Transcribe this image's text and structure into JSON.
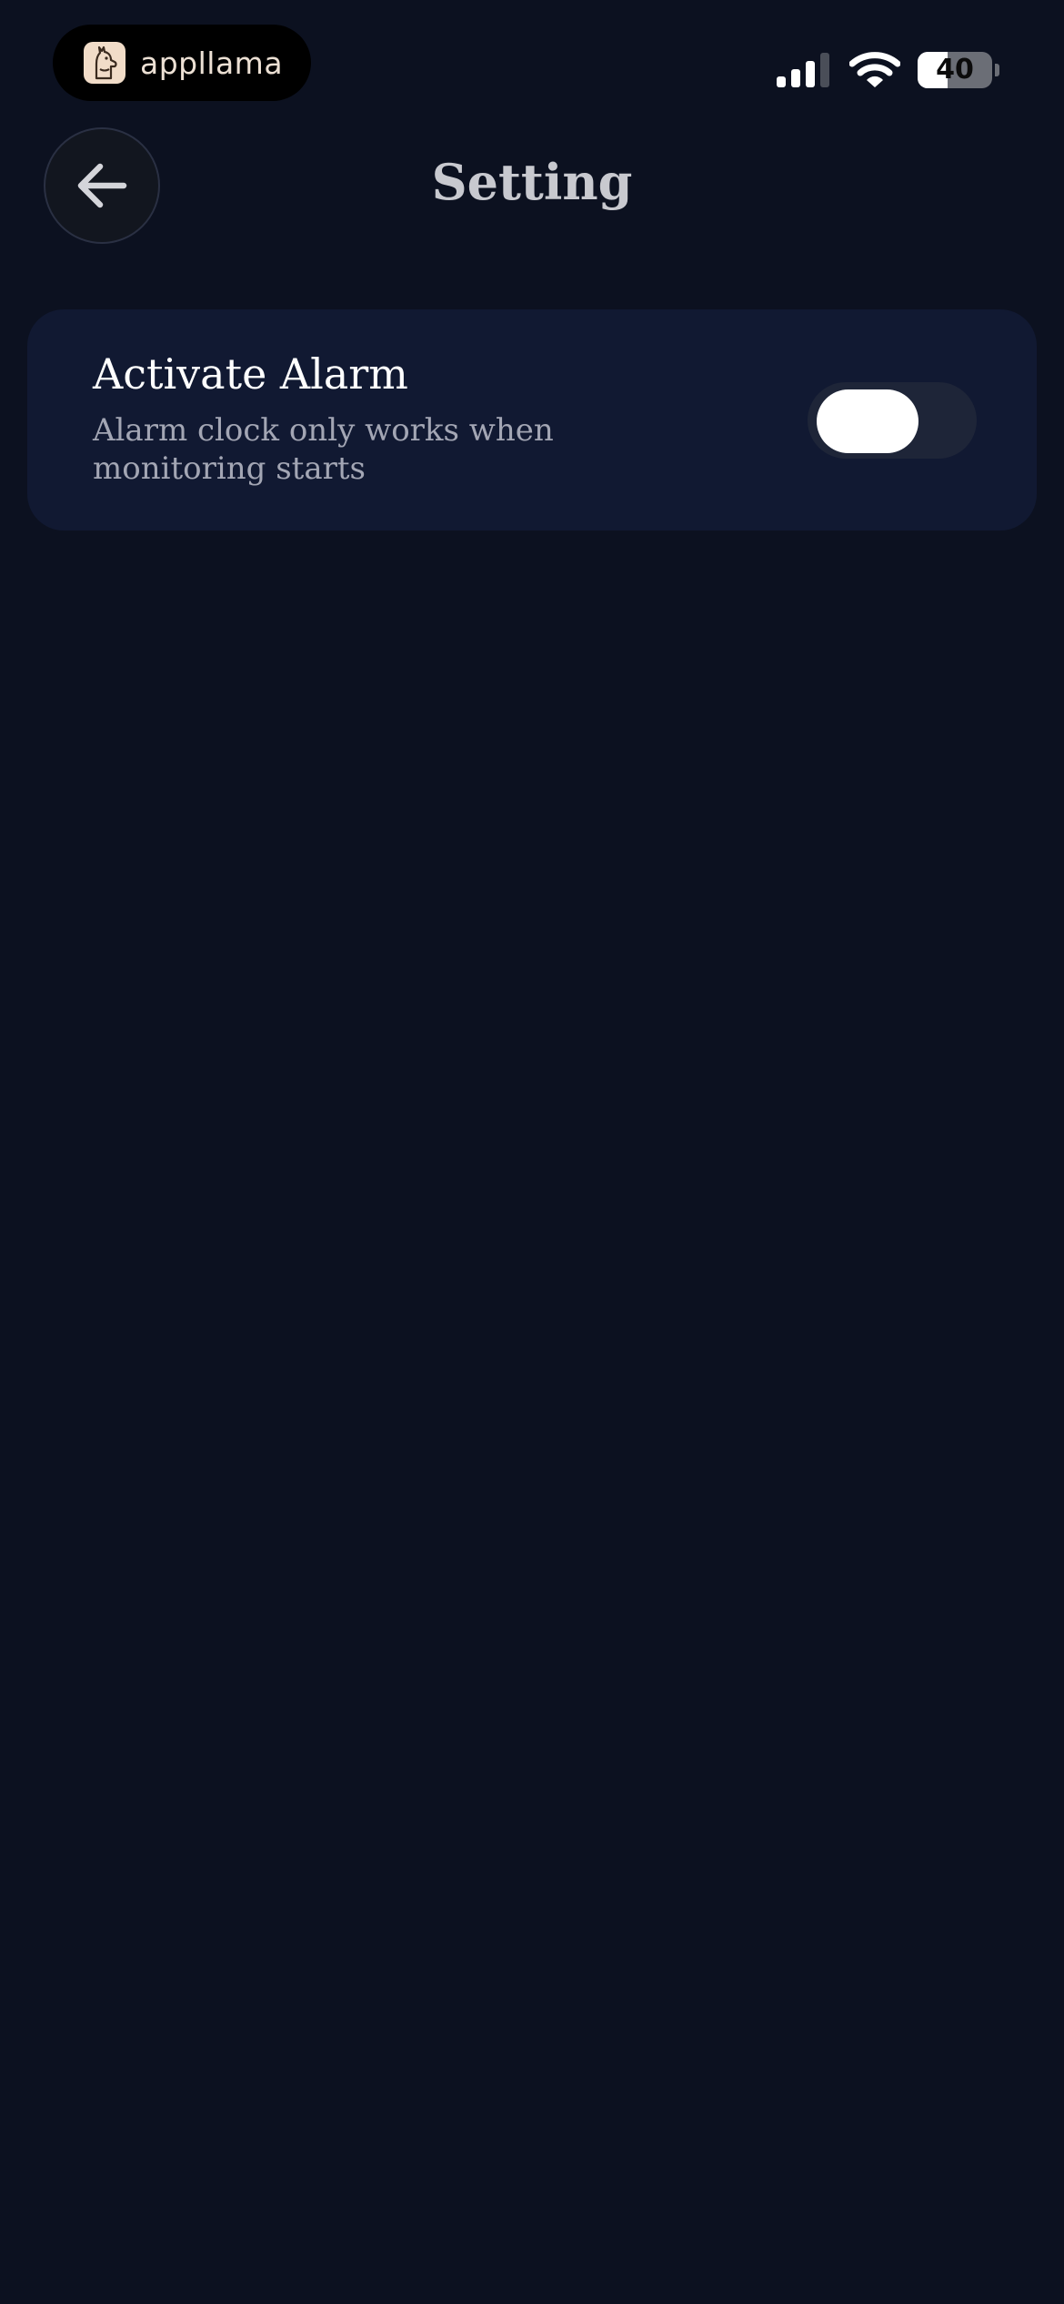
{
  "status_bar": {
    "app_name": "appllama",
    "battery_level": "40",
    "battery_fraction": 0.4,
    "icons": [
      "llama-logo-icon",
      "cellular-signal-icon",
      "wifi-icon",
      "battery-icon"
    ]
  },
  "header": {
    "title": "Setting",
    "back_icon": "arrow-left-icon"
  },
  "settings": {
    "alarm": {
      "title": "Activate Alarm",
      "description": "Alarm clock only works when monitoring starts",
      "enabled": false
    }
  },
  "colors": {
    "background": "#0c1120",
    "card": "#111932",
    "toggle_track": "#1e2538",
    "toggle_knob": "#ffffff",
    "title_text": "#c8c9cf",
    "secondary_text": "#a3a6b4"
  }
}
